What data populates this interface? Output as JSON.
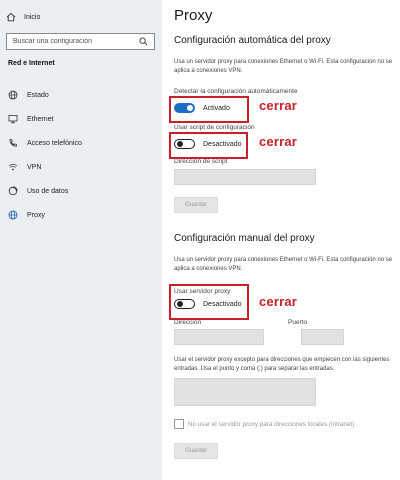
{
  "sidebar": {
    "home_label": "Inicio",
    "search_placeholder": "Buscar una configuración",
    "section_title": "Red e Internet",
    "items": [
      {
        "label": "Estado",
        "icon": "globe-icon"
      },
      {
        "label": "Ethernet",
        "icon": "monitor-icon"
      },
      {
        "label": "Acceso telefónico",
        "icon": "phone-icon"
      },
      {
        "label": "VPN",
        "icon": "vpn-icon"
      },
      {
        "label": "Uso de datos",
        "icon": "data-usage-icon"
      },
      {
        "label": "Proxy",
        "icon": "globe-icon",
        "active": true
      }
    ]
  },
  "main": {
    "title": "Proxy",
    "auto": {
      "heading": "Configuración automática del proxy",
      "description": "Usa un servidor proxy para conexiones Ethernet o Wi-Fi. Esta configuración no se aplica a conexiones VPN.",
      "detect_label": "Detectar la configuración automáticamente",
      "detect_state": "Activado",
      "script_label": "Usar script de configuración",
      "script_state": "Desactivado",
      "script_address_label": "Dirección de script",
      "save_label": "Guardar"
    },
    "manual": {
      "heading": "Configuración manual del proxy",
      "description": "Usa un servidor proxy para conexiones Ethernet o Wi-Fi. Esta configuración no se aplica a conexiones VPN.",
      "use_proxy_label": "Usar servidor proxy",
      "use_proxy_state": "Desactivado",
      "address_label": "Dirección",
      "port_label": "Puerto",
      "exceptions_label": "Usar el servidor proxy excepto para direcciones que empiecen con las siguientes entradas. Usa el punto y coma (;) para separar las entradas.",
      "local_checkbox_label": "No usar el servidor proxy para direcciones locales (intranet)",
      "save_label": "Guardar"
    }
  },
  "annotations": {
    "text1": "cerrar",
    "text2": "cerrar",
    "text3": "cerrar",
    "color": "#c8202a"
  },
  "colors": {
    "accent": "#1a6fc4",
    "sidebar_bg": "#eaeff4"
  }
}
